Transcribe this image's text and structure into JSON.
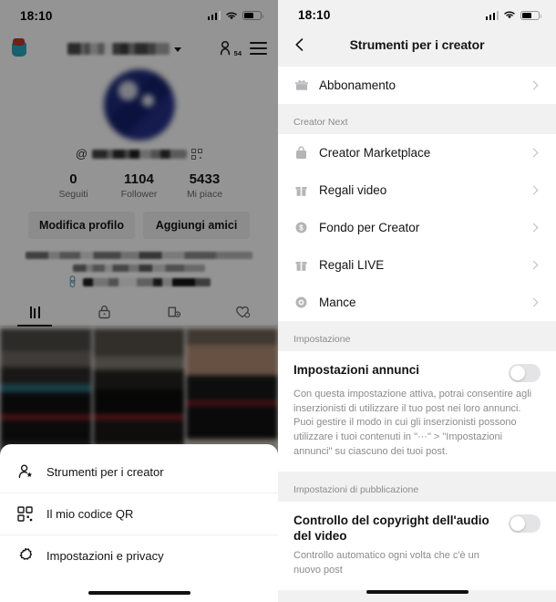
{
  "left": {
    "status": {
      "time": "18:10",
      "signal_icon": "signal-bars-icon",
      "wifi_icon": "wifi-icon",
      "battery_icon": "battery-icon"
    },
    "header": {
      "shop_icon": "shop-bag-icon",
      "shop_badge": "NEW",
      "username_redacted": "",
      "dropdown_icon": "chevron-down-icon",
      "friends_icon": "add-friends-icon",
      "friends_badge": "54",
      "menu_icon": "hamburger-menu-icon"
    },
    "profile": {
      "avatar": "profile-avatar",
      "at_symbol": "@",
      "handle_redacted": "",
      "qr_icon": "qr-code-icon"
    },
    "stats": [
      {
        "value": "0",
        "label": "Seguiti"
      },
      {
        "value": "1104",
        "label": "Follower"
      },
      {
        "value": "5433",
        "label": "Mi piace"
      }
    ],
    "actions": [
      {
        "label": "Modifica profilo"
      },
      {
        "label": "Aggiungi amici"
      }
    ],
    "bio": {
      "link_icon": "link-icon"
    },
    "tabs": [
      {
        "icon": "grid-posts-icon",
        "active": true
      },
      {
        "icon": "lock-private-icon",
        "active": false
      },
      {
        "icon": "repost-icon",
        "active": false
      },
      {
        "icon": "heart-liked-icon",
        "active": false
      }
    ],
    "sheet": {
      "items": [
        {
          "label": "Strumenti per i creator",
          "icon": "creator-tools-icon"
        },
        {
          "label": "Il mio codice QR",
          "icon": "qr-code-icon"
        },
        {
          "label": "Impostazioni e privacy",
          "icon": "gear-settings-icon"
        }
      ],
      "home_indicator": "home-indicator"
    }
  },
  "right": {
    "status": {
      "time": "18:10",
      "signal_icon": "signal-bars-icon",
      "wifi_icon": "wifi-icon",
      "battery_icon": "battery-icon"
    },
    "header": {
      "back_icon": "back-chevron-icon",
      "title": "Strumenti per i creator"
    },
    "subscription": {
      "label": "Abbonamento",
      "icon": "subscription-icon",
      "chevron": "chevron-right-icon"
    },
    "creator_next": {
      "section_title": "Creator Next",
      "items": [
        {
          "label": "Creator Marketplace",
          "icon": "marketplace-bag-icon"
        },
        {
          "label": "Regali video",
          "icon": "gift-video-icon"
        },
        {
          "label": "Fondo per Creator",
          "icon": "dollar-coin-icon"
        },
        {
          "label": "Regali LIVE",
          "icon": "gift-live-icon"
        },
        {
          "label": "Mance",
          "icon": "tips-coin-icon"
        }
      ]
    },
    "settings": {
      "section_title": "Impostazione",
      "ads": {
        "title": "Impostazioni annunci",
        "description": "Con questa impostazione attiva, potrai consentire agli inserzionisti di utilizzare il tuo post nei loro annunci. Puoi gestire il modo in cui gli inserzionisti possono utilizzare i tuoi contenuti in \"···\" > \"Impostazioni annunci\" su ciascuno dei tuoi post.",
        "toggle_state": "off"
      }
    },
    "publishing": {
      "section_title": "Impostazioni di pubblicazione",
      "copyright": {
        "title": "Controllo del copyright dell'audio del video",
        "subtitle": "Controllo automatico ogni volta che c'è un nuovo post",
        "toggle_state": "off"
      }
    },
    "home_indicator": "home-indicator"
  },
  "colors": {
    "page_bg": "#f1f1f2",
    "card_bg": "#ffffff",
    "text_primary": "#141414",
    "text_secondary": "#8b8b8b",
    "toggle_off": "#e4e4e6",
    "shop_icon": "#2aa8bd",
    "badge_red": "#c0392b"
  }
}
